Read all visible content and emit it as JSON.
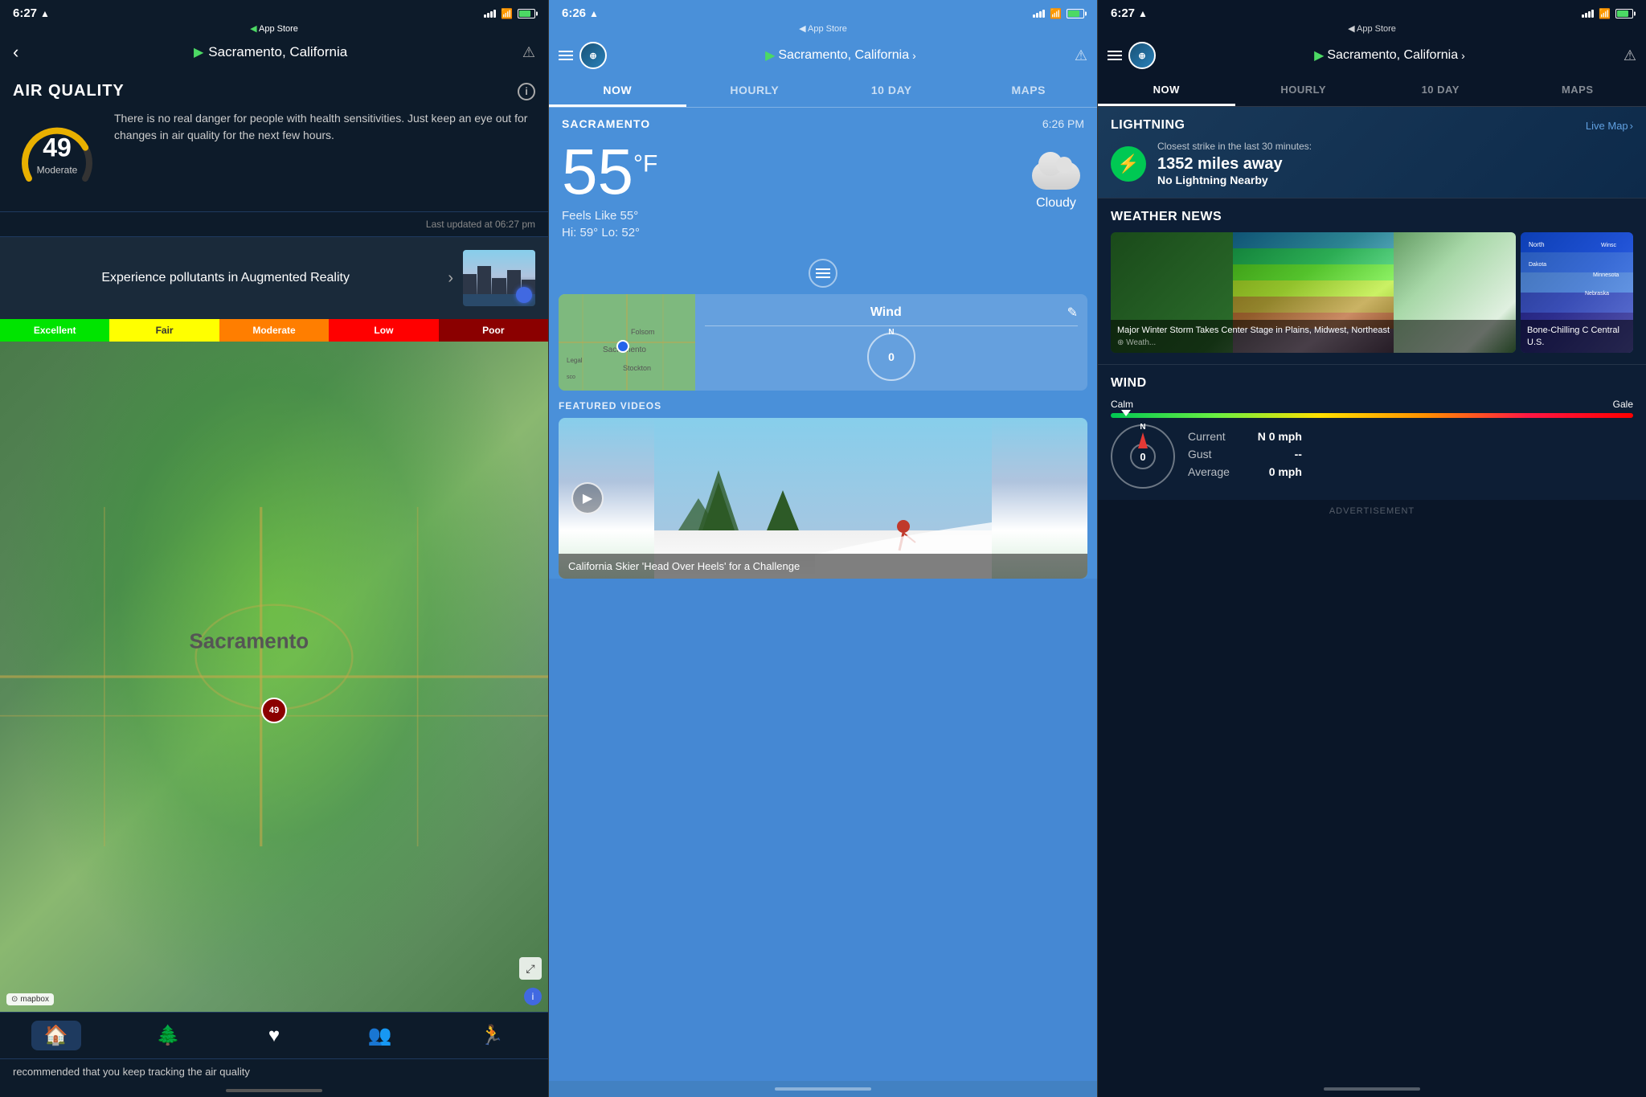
{
  "panel1": {
    "statusBar": {
      "time": "6:27",
      "gps": "◀",
      "appStore": "App Store"
    },
    "nav": {
      "back": "‹",
      "location": "Sacramento, California",
      "alert": "⚠"
    },
    "airQuality": {
      "title": "AIR QUALITY",
      "number": "49",
      "label": "Moderate",
      "description": "There is no real danger for people with health sensitivities. Just keep an eye out for changes in air quality for the next few hours.",
      "lastUpdated": "Last updated at 06:27 pm"
    },
    "arBanner": {
      "text": "Experience pollutants in Augmented Reality",
      "chevron": "›"
    },
    "scale": {
      "excellent": "Excellent",
      "fair": "Fair",
      "moderate": "Moderate",
      "low": "Low",
      "poor": "Poor"
    },
    "map": {
      "cityLabel": "Sacramento",
      "pinValue": "49",
      "mapboxLabel": "mapbox"
    },
    "nav_bottom": {
      "items": [
        "🏠",
        "🌲",
        "♥",
        "👥",
        "🏃"
      ]
    },
    "bottomText": "recommended that you keep tracking the air quality"
  },
  "panel2": {
    "statusBar": {
      "time": "6:26"
    },
    "nav": {
      "location": "Sacramento, California",
      "alert": "⚠"
    },
    "tabs": [
      "NOW",
      "HOURLY",
      "10 DAY",
      "MAPS"
    ],
    "activeTab": 0,
    "cityBar": {
      "name": "SACRAMENTO",
      "time": "6:26 PM"
    },
    "weather": {
      "temp": "55",
      "unit": "°F",
      "feelsLike": "Feels Like 55°",
      "hiLo": "Hi: 59°  Lo: 52°",
      "condition": "Cloudy"
    },
    "wind": {
      "title": "Wind",
      "compassValue": "0",
      "compassN": "N"
    },
    "featuredVideos": {
      "title": "FEATURED VIDEOS",
      "caption": "California Skier 'Head Over Heels' for a Challenge"
    }
  },
  "panel3": {
    "statusBar": {
      "time": "6:27"
    },
    "nav": {
      "location": "Sacramento, California",
      "alert": "⚠"
    },
    "tabs": [
      "NOW",
      "HOURLY",
      "10 DAY",
      "MAPS"
    ],
    "activeTab": 0,
    "lightning": {
      "title": "LIGHTNING",
      "link": "Live Map",
      "subtitle": "Closest strike in the last 30 minutes:",
      "distance": "1352 miles away",
      "status": "No Lightning Nearby"
    },
    "weatherNews": {
      "title": "WEATHER NEWS",
      "article1": "Major Winter Storm Takes Center Stage in Plains, Midwest, Northeast",
      "article1Source": "⊕ Weath...",
      "article2": "Bone-Chilling C Central U.S."
    },
    "wind": {
      "title": "WIND",
      "calm": "Calm",
      "gale": "Gale",
      "current": "N 0 mph",
      "gust": "--",
      "average": "0 mph",
      "compassValue": "0"
    },
    "advertisement": "ADVERTISEMENT"
  }
}
